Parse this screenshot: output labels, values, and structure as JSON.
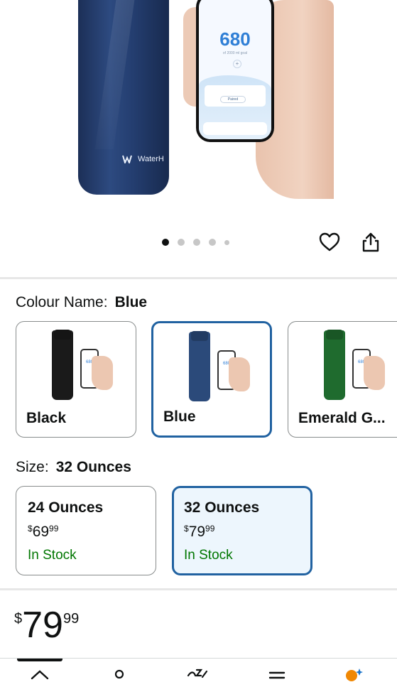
{
  "hero": {
    "bottle_brand": "WaterH",
    "phone_value": "680",
    "phone_goal": "of 2000 ml goal",
    "phone_status": "Paired"
  },
  "carousel": {
    "total": 5,
    "active": 0
  },
  "colour": {
    "label": "Colour Name:",
    "selected": "Blue",
    "options": [
      {
        "name": "Black",
        "bottle_color": "#1a1a1a",
        "accent": "#3aa0ff",
        "screen": "680",
        "selected": false
      },
      {
        "name": "Blue",
        "bottle_color": "#2b4a7a",
        "accent": "#3aa0ff",
        "screen": "680",
        "selected": true
      },
      {
        "name": "Emerald G...",
        "bottle_color": "#1f6b2e",
        "accent": "#3aa0ff",
        "screen": "680",
        "selected": false
      }
    ]
  },
  "size": {
    "label": "Size:",
    "selected": "32 Ounces",
    "options": [
      {
        "name": "24 Ounces",
        "currency": "$",
        "whole": "69",
        "fraction": "99",
        "stock": "In Stock",
        "selected": false
      },
      {
        "name": "32 Ounces",
        "currency": "$",
        "whole": "79",
        "fraction": "99",
        "stock": "In Stock",
        "selected": true
      }
    ]
  },
  "price": {
    "currency": "$",
    "whole": "79",
    "fraction": "99"
  },
  "colors": {
    "selected_border": "#2162a1",
    "selected_bg": "#edf6fd",
    "in_stock": "#007600"
  },
  "icons": {
    "wishlist": "heart-icon",
    "share": "share-icon",
    "nav": [
      "home-icon",
      "account-icon",
      "ai-assistant-icon",
      "menu-icon",
      "rufus-icon"
    ]
  }
}
